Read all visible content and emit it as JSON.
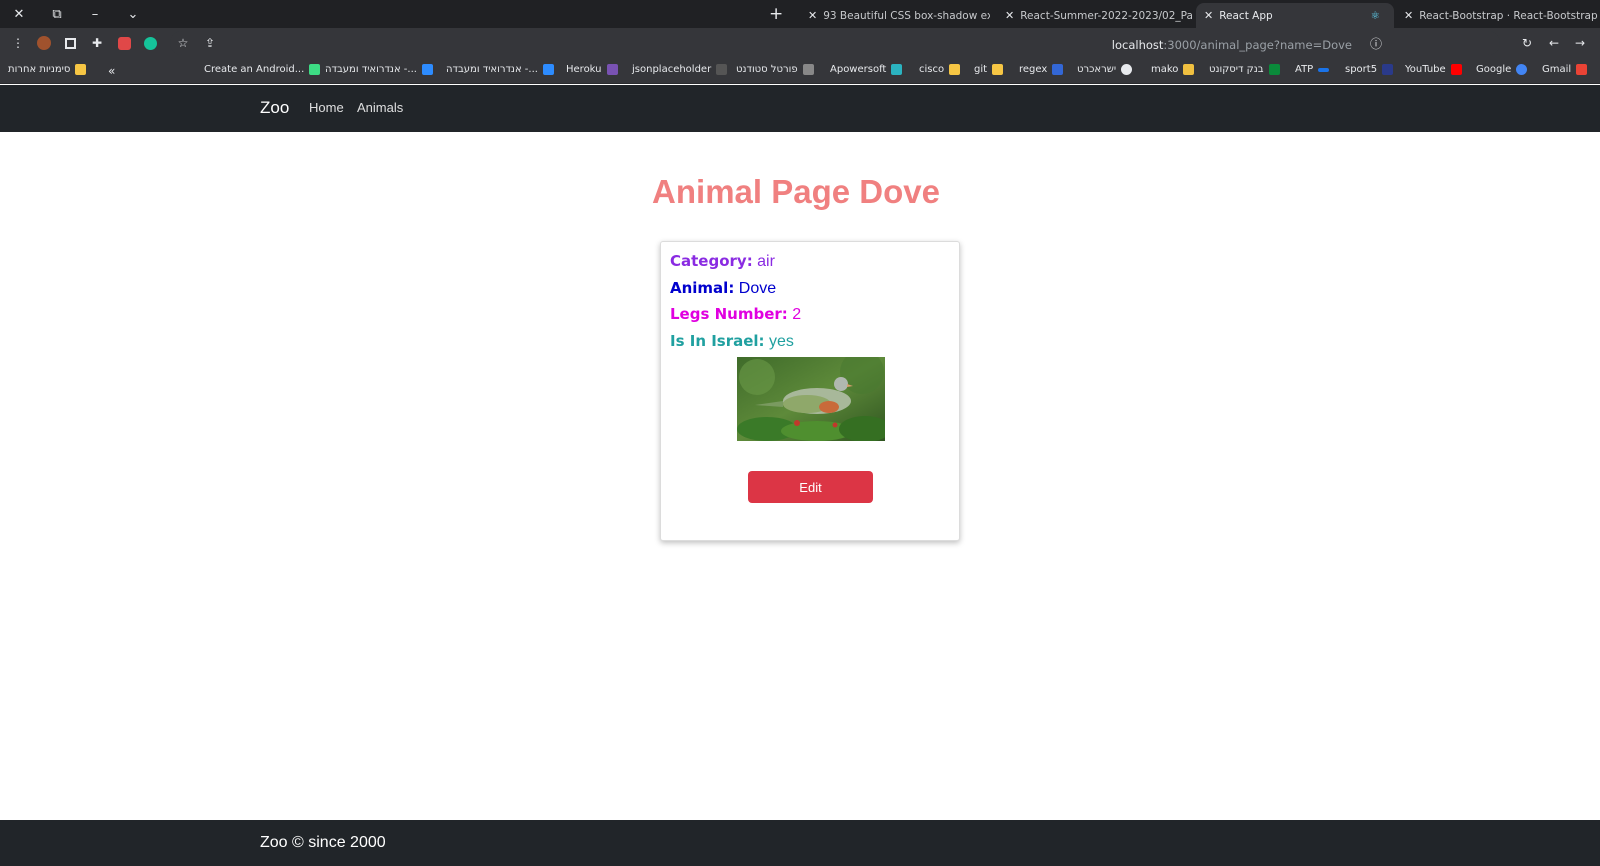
{
  "browser": {
    "tabs": [
      {
        "title": "93 Beautiful CSS box-shadow exa"
      },
      {
        "title": "React-Summer-2022-2023/02_Pa"
      },
      {
        "title": "React App"
      },
      {
        "title": "React-Bootstrap · React-Bootstrap"
      }
    ],
    "url": {
      "host": "localhost",
      "path": ":3000/animal_page?name=Dove"
    },
    "bookmarks": [
      {
        "label": "Gmail"
      },
      {
        "label": "Google"
      },
      {
        "label": "YouTube"
      },
      {
        "label": "sport5"
      },
      {
        "label": "ATP"
      },
      {
        "label": "בנק דיסקונט"
      },
      {
        "label": "mako"
      },
      {
        "label": "ישראכרט"
      },
      {
        "label": "regex"
      },
      {
        "label": "git"
      },
      {
        "label": "cisco"
      },
      {
        "label": "Apowersoft"
      },
      {
        "label": "פורטל סטודנט"
      },
      {
        "label": "jsonplaceholder"
      },
      {
        "label": "Heroku"
      },
      {
        "label": "אנדרואיד ומעבדה -..."
      },
      {
        "label": "אנדרואיד ומעבדה -..."
      },
      {
        "label": "Create an Android..."
      },
      {
        "label": "סימניות אחרות"
      }
    ]
  },
  "navbar": {
    "brand": "Zoo",
    "links": [
      "Home",
      "Animals"
    ]
  },
  "page": {
    "title": "Animal Page Dove"
  },
  "card": {
    "category": {
      "label": "Category:",
      "value": "air"
    },
    "animal": {
      "label": "Animal:",
      "value": "Dove"
    },
    "legs": {
      "label": "Legs Number:",
      "value": "2"
    },
    "in_israel": {
      "label": "Is In Israel:",
      "value": "yes"
    },
    "edit_label": "Edit"
  },
  "footer": {
    "text": "Zoo © since 2000"
  },
  "colors": {
    "title": "#f08080",
    "category": "#8a2be2",
    "animal": "#0000cd",
    "legs": "#e000e0",
    "in_israel": "#20a0a0",
    "edit": "#dc3545",
    "navbar": "#212529"
  }
}
